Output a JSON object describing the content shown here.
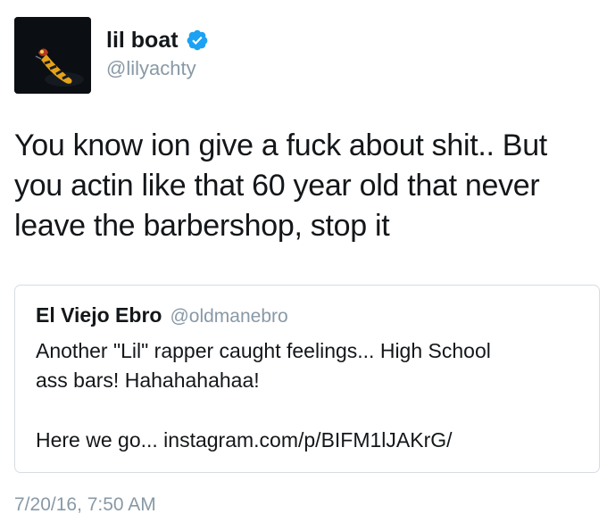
{
  "author": {
    "display_name": "lil boat",
    "handle": "@lilyachty",
    "verified": true,
    "avatar_icon": "avatar-image"
  },
  "tweet": {
    "lines": [
      "You know ion give a fuck about shit.. But",
      "you actin like that 60 year old that never",
      "leave the barbershop, stop it"
    ]
  },
  "quoted_tweet": {
    "display_name": "El Viejo Ebro",
    "handle": "@oldmanebro",
    "lines": [
      "Another \"Lil\" rapper caught feelings... High  School",
      "ass bars! Hahahahahaa!"
    ],
    "link_line": "Here we go... instagram.com/p/BIFM1lJAKrG/"
  },
  "timestamp": "7/20/16, 7:50 AM",
  "colors": {
    "verified_blue": "#1da1f2",
    "secondary_text": "#8899a6",
    "border": "#d6dde3"
  }
}
